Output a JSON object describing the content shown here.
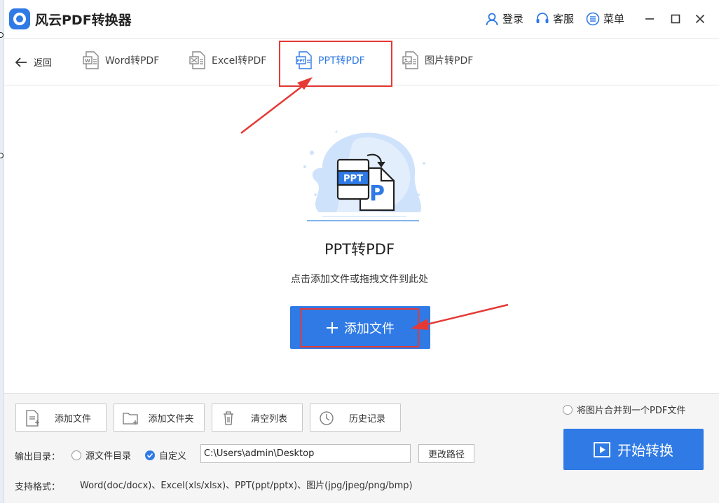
{
  "window": {
    "title": "风云PDF转换器",
    "login_label": "登录",
    "service_label": "客服",
    "menu_label": "菜单"
  },
  "nav": {
    "back_label": "返回",
    "tabs": [
      {
        "label": "Word转PDF",
        "icon": "word-doc-icon"
      },
      {
        "label": "Excel转PDF",
        "icon": "excel-doc-icon"
      },
      {
        "label": "PPT转PDF",
        "icon": "ppt-doc-icon",
        "active": true
      },
      {
        "label": "图片转PDF",
        "icon": "image-doc-icon"
      }
    ]
  },
  "main": {
    "illustration": {
      "badge_ppt": "PPT",
      "badge_pdf": "P"
    },
    "title": "PPT转PDF",
    "hint": "点击添加文件或拖拽文件到此处",
    "add_button_label": "添加文件"
  },
  "bottom": {
    "toolbar": [
      {
        "label": "添加文件",
        "icon": "add-file-icon"
      },
      {
        "label": "添加文件夹",
        "icon": "add-folder-icon"
      },
      {
        "label": "清空列表",
        "icon": "trash-icon"
      },
      {
        "label": "历史记录",
        "icon": "clock-icon"
      }
    ],
    "output_label": "输出目录：",
    "source_dir_option": "源文件目录",
    "custom_option": "自定义",
    "output_path": "C:\\Users\\admin\\Desktop",
    "change_path_label": "更改路径",
    "formats_label": "支持格式：",
    "formats_value": "Word(doc/docx)、Excel(xls/xlsx)、PPT(ppt/pptx)、图片(jpg/jpeg/png/bmp)",
    "merge_option": "将图片合并到一个PDF文件",
    "start_label": "开始转换"
  },
  "colors": {
    "accent": "#2f7ae5",
    "annotation": "#e53935"
  }
}
